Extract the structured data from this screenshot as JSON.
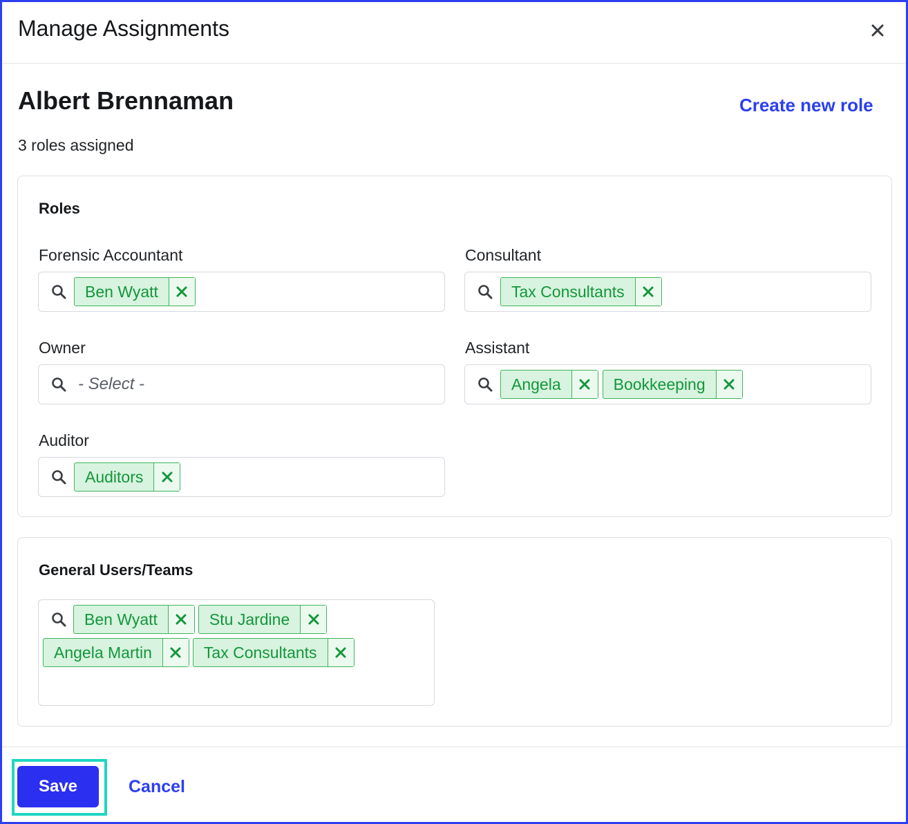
{
  "modal": {
    "title": "Manage Assignments",
    "close_icon": "close-icon"
  },
  "person": {
    "name": "Albert Brennaman",
    "roles_count": "3 roles assigned",
    "create_role_label": "Create new role"
  },
  "roles_card": {
    "title": "Roles",
    "fields": [
      {
        "label": "Forensic Accountant",
        "tags": [
          "Ben Wyatt"
        ]
      },
      {
        "label": "Consultant",
        "tags": [
          "Tax Consultants"
        ]
      },
      {
        "label": "Owner",
        "tags": [],
        "placeholder": "- Select -"
      },
      {
        "label": "Assistant",
        "tags": [
          "Angela",
          "Bookkeeping"
        ]
      },
      {
        "label": "Auditor",
        "tags": [
          "Auditors"
        ]
      }
    ]
  },
  "general_card": {
    "title": "General Users/Teams",
    "tags": [
      "Ben Wyatt",
      "Stu Jardine",
      "Angela Martin",
      "Tax Consultants"
    ]
  },
  "footer": {
    "save_label": "Save",
    "cancel_label": "Cancel"
  },
  "colors": {
    "accent": "#2b3ff0",
    "tag_bg": "#d8f3df",
    "tag_text": "#13963b",
    "focus_ring": "#1fd6c2"
  }
}
